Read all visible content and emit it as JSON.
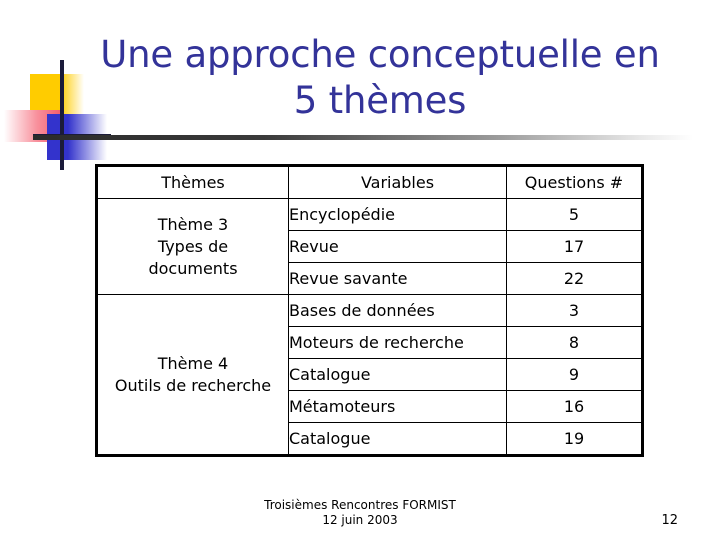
{
  "slide": {
    "title": "Une approche conceptuelle en\n5 thèmes",
    "accent_color": "#333399",
    "decoration": {
      "yellow": "#ffcc00",
      "red": "#f25668",
      "blue": "#3333cc",
      "line": "#1b1b3a"
    }
  },
  "table": {
    "headers": {
      "themes": "Thèmes",
      "variables": "Variables",
      "questions": "Questions #"
    },
    "groups": [
      {
        "theme_label": "Thème 3\nTypes de\ndocuments",
        "rows": [
          {
            "variable": "Encyclopédie",
            "questions": "5"
          },
          {
            "variable": "Revue",
            "questions": "17"
          },
          {
            "variable": "Revue savante",
            "questions": "22"
          }
        ]
      },
      {
        "theme_label": "Thème 4\nOutils de recherche",
        "rows": [
          {
            "variable": "Bases de données",
            "questions": "3"
          },
          {
            "variable": "Moteurs de recherche",
            "questions": "8"
          },
          {
            "variable": "Catalogue",
            "questions": "9"
          },
          {
            "variable": "Métamoteurs",
            "questions": "16"
          },
          {
            "variable": "Catalogue",
            "questions": "19"
          }
        ]
      }
    ]
  },
  "footer": {
    "line1": "Troisièmes Rencontres FORMIST",
    "line2": "12 juin 2003",
    "page_number": "12"
  }
}
